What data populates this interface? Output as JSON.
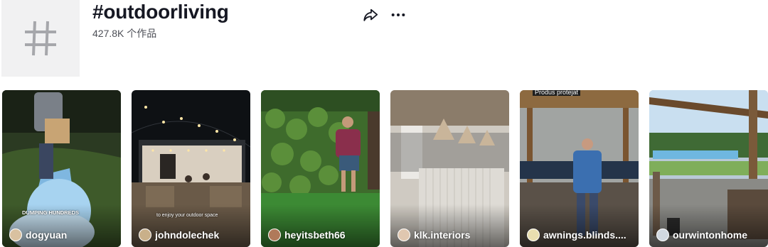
{
  "header": {
    "title": "#outdoorliving",
    "count": "427.8K 个作品",
    "avatar_icon": "hashtag-icon",
    "share_icon": "share-arrow-icon",
    "more_icon": "more-horizontal-icon"
  },
  "videos": [
    {
      "username": "dogyuan",
      "caption": "DUMPING HUNDREDS",
      "thumb_colors": [
        "#3a4a2a",
        "#5aa6d8"
      ]
    },
    {
      "username": "johndolechek",
      "caption": "to enjoy your outdoor space",
      "thumb_colors": [
        "#101418",
        "#c9b79a"
      ]
    },
    {
      "username": "heyitsbeth66",
      "caption": "",
      "thumb_colors": [
        "#3f6b2c",
        "#2f8a35"
      ]
    },
    {
      "username": "klk.interiors",
      "caption": "",
      "thumb_colors": [
        "#8a7a66",
        "#d6d4d0"
      ]
    },
    {
      "username": "awnings.blinds....",
      "caption": "Produs protejat",
      "thumb_colors": [
        "#8a6a45",
        "#3b6fb0"
      ]
    },
    {
      "username": "ourwintonhome",
      "caption": "",
      "thumb_colors": [
        "#9fc6e8",
        "#7a5a3a"
      ]
    }
  ]
}
